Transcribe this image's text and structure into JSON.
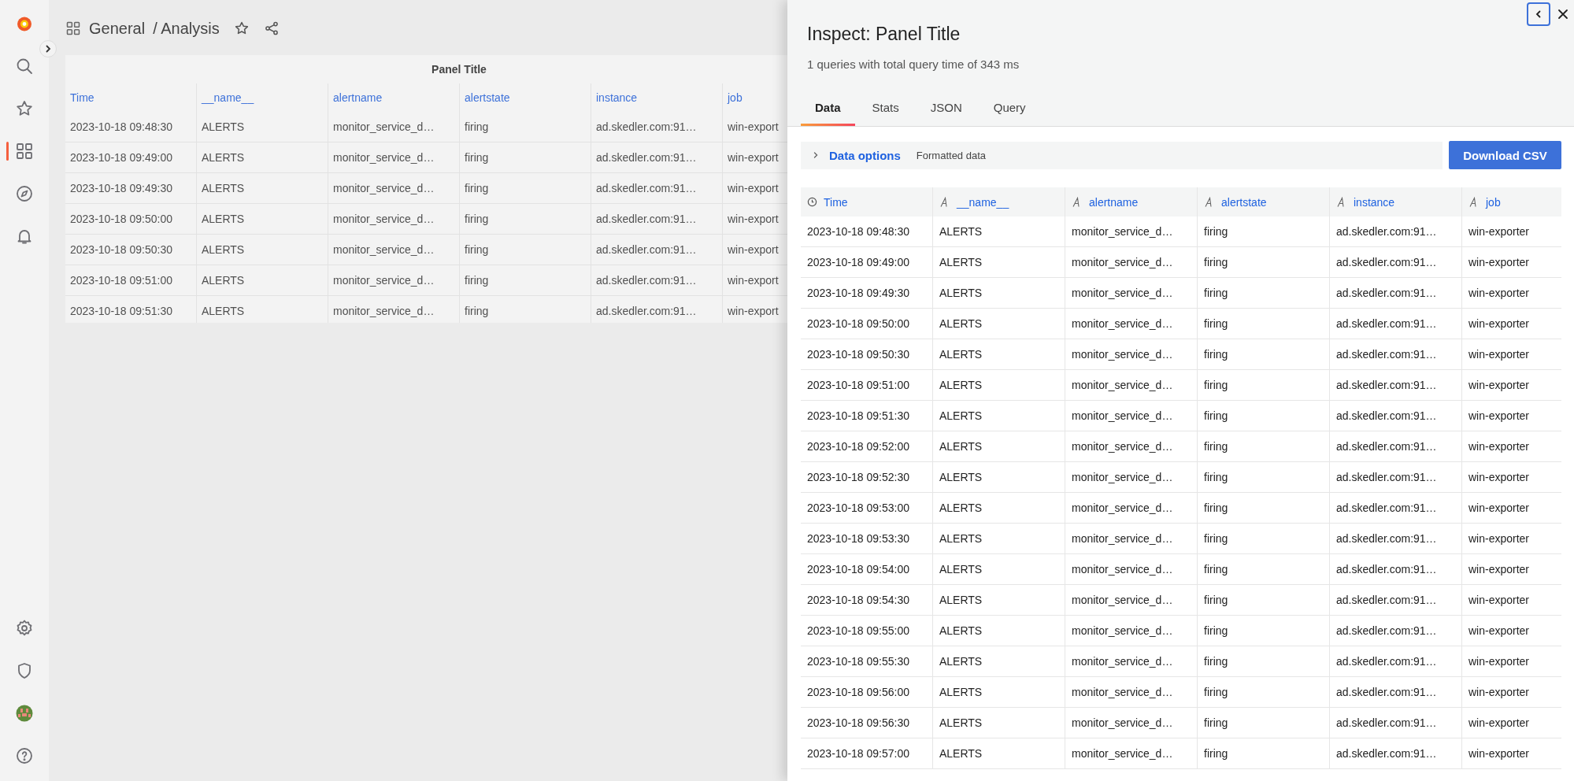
{
  "sidebar": {
    "items": [
      {
        "kind": "logo",
        "selected": false
      },
      {
        "kind": "search",
        "selected": false
      },
      {
        "kind": "star",
        "selected": false
      },
      {
        "kind": "dashboards",
        "selected": true
      },
      {
        "kind": "compass",
        "selected": false
      },
      {
        "kind": "bell",
        "selected": false
      }
    ],
    "bottom_items": [
      {
        "kind": "gear",
        "selected": false
      },
      {
        "kind": "shield",
        "selected": false
      },
      {
        "kind": "avatar",
        "selected": false
      },
      {
        "kind": "help",
        "selected": false
      }
    ]
  },
  "breadcrumb": {
    "folder": "General",
    "dashboard": "/ Analysis"
  },
  "panel": {
    "title": "Panel Title",
    "columns": [
      "Time",
      "__name__",
      "alertname",
      "alertstate",
      "instance",
      "job"
    ],
    "rows": [
      [
        "2023-10-18 09:48:30",
        "ALERTS",
        "monitor_service_d…",
        "firing",
        "ad.skedler.com:91…",
        "win-export"
      ],
      [
        "2023-10-18 09:49:00",
        "ALERTS",
        "monitor_service_d…",
        "firing",
        "ad.skedler.com:91…",
        "win-export"
      ],
      [
        "2023-10-18 09:49:30",
        "ALERTS",
        "monitor_service_d…",
        "firing",
        "ad.skedler.com:91…",
        "win-export"
      ],
      [
        "2023-10-18 09:50:00",
        "ALERTS",
        "monitor_service_d…",
        "firing",
        "ad.skedler.com:91…",
        "win-export"
      ],
      [
        "2023-10-18 09:50:30",
        "ALERTS",
        "monitor_service_d…",
        "firing",
        "ad.skedler.com:91…",
        "win-export"
      ],
      [
        "2023-10-18 09:51:00",
        "ALERTS",
        "monitor_service_d…",
        "firing",
        "ad.skedler.com:91…",
        "win-export"
      ],
      [
        "2023-10-18 09:51:30",
        "ALERTS",
        "monitor_service_d…",
        "firing",
        "ad.skedler.com:91…",
        "win-export"
      ]
    ]
  },
  "inspect": {
    "title": "Inspect: Panel Title",
    "subtitle": "1 queries with total query time of 343 ms",
    "tabs": [
      {
        "label": "Data",
        "selected": true
      },
      {
        "label": "Stats",
        "selected": false
      },
      {
        "label": "JSON",
        "selected": false
      },
      {
        "label": "Query",
        "selected": false
      }
    ],
    "data_options": {
      "label": "Data options",
      "expanded": false,
      "summary": "Formatted data"
    },
    "download_button": "Download CSV",
    "table": {
      "columns": [
        {
          "label": "Time",
          "kind": "time"
        },
        {
          "label": "__name__",
          "kind": "string"
        },
        {
          "label": "alertname",
          "kind": "string"
        },
        {
          "label": "alertstate",
          "kind": "string"
        },
        {
          "label": "instance",
          "kind": "string"
        },
        {
          "label": "job",
          "kind": "string"
        }
      ],
      "rows": [
        [
          "2023-10-18 09:48:30",
          "ALERTS",
          "monitor_service_d…",
          "firing",
          "ad.skedler.com:91…",
          "win-exporter"
        ],
        [
          "2023-10-18 09:49:00",
          "ALERTS",
          "monitor_service_d…",
          "firing",
          "ad.skedler.com:91…",
          "win-exporter"
        ],
        [
          "2023-10-18 09:49:30",
          "ALERTS",
          "monitor_service_d…",
          "firing",
          "ad.skedler.com:91…",
          "win-exporter"
        ],
        [
          "2023-10-18 09:50:00",
          "ALERTS",
          "monitor_service_d…",
          "firing",
          "ad.skedler.com:91…",
          "win-exporter"
        ],
        [
          "2023-10-18 09:50:30",
          "ALERTS",
          "monitor_service_d…",
          "firing",
          "ad.skedler.com:91…",
          "win-exporter"
        ],
        [
          "2023-10-18 09:51:00",
          "ALERTS",
          "monitor_service_d…",
          "firing",
          "ad.skedler.com:91…",
          "win-exporter"
        ],
        [
          "2023-10-18 09:51:30",
          "ALERTS",
          "monitor_service_d…",
          "firing",
          "ad.skedler.com:91…",
          "win-exporter"
        ],
        [
          "2023-10-18 09:52:00",
          "ALERTS",
          "monitor_service_d…",
          "firing",
          "ad.skedler.com:91…",
          "win-exporter"
        ],
        [
          "2023-10-18 09:52:30",
          "ALERTS",
          "monitor_service_d…",
          "firing",
          "ad.skedler.com:91…",
          "win-exporter"
        ],
        [
          "2023-10-18 09:53:00",
          "ALERTS",
          "monitor_service_d…",
          "firing",
          "ad.skedler.com:91…",
          "win-exporter"
        ],
        [
          "2023-10-18 09:53:30",
          "ALERTS",
          "monitor_service_d…",
          "firing",
          "ad.skedler.com:91…",
          "win-exporter"
        ],
        [
          "2023-10-18 09:54:00",
          "ALERTS",
          "monitor_service_d…",
          "firing",
          "ad.skedler.com:91…",
          "win-exporter"
        ],
        [
          "2023-10-18 09:54:30",
          "ALERTS",
          "monitor_service_d…",
          "firing",
          "ad.skedler.com:91…",
          "win-exporter"
        ],
        [
          "2023-10-18 09:55:00",
          "ALERTS",
          "monitor_service_d…",
          "firing",
          "ad.skedler.com:91…",
          "win-exporter"
        ],
        [
          "2023-10-18 09:55:30",
          "ALERTS",
          "monitor_service_d…",
          "firing",
          "ad.skedler.com:91…",
          "win-exporter"
        ],
        [
          "2023-10-18 09:56:00",
          "ALERTS",
          "monitor_service_d…",
          "firing",
          "ad.skedler.com:91…",
          "win-exporter"
        ],
        [
          "2023-10-18 09:56:30",
          "ALERTS",
          "monitor_service_d…",
          "firing",
          "ad.skedler.com:91…",
          "win-exporter"
        ],
        [
          "2023-10-18 09:57:00",
          "ALERTS",
          "monitor_service_d…",
          "firing",
          "ad.skedler.com:91…",
          "win-exporter"
        ]
      ]
    }
  }
}
